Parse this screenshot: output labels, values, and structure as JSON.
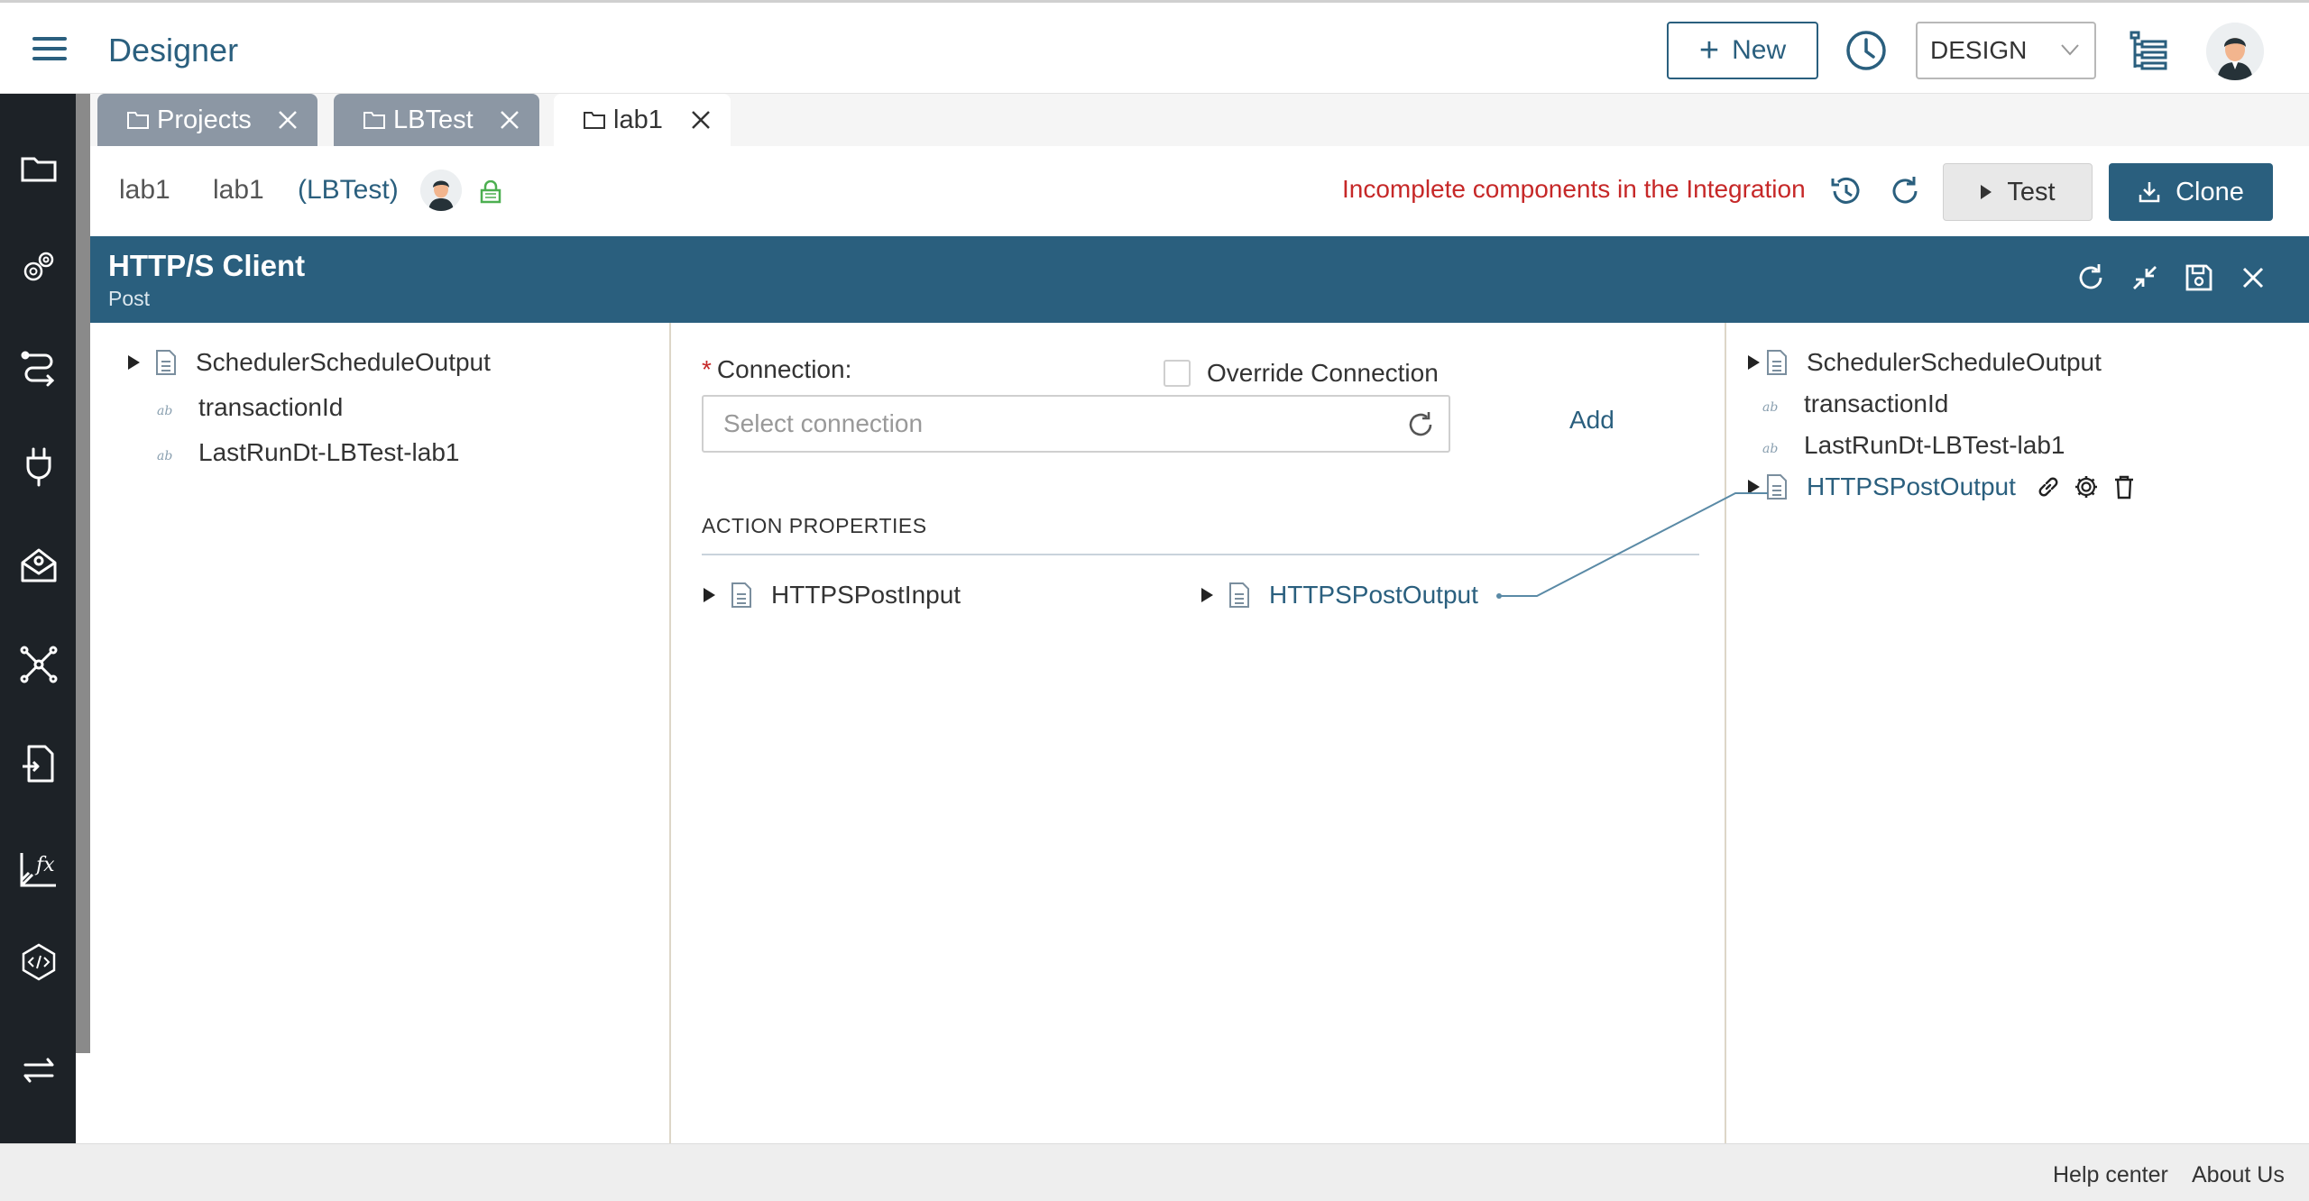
{
  "header": {
    "app_title": "Designer",
    "new_button": "New",
    "mode_select_value": "DESIGN"
  },
  "tabs": [
    {
      "label": "Projects",
      "active": false
    },
    {
      "label": "LBTest",
      "active": false
    },
    {
      "label": "lab1",
      "active": true
    }
  ],
  "infobar": {
    "crumb1": "lab1",
    "crumb2": "lab1",
    "project": "(LBTest)",
    "warning": "Incomplete components in the Integration",
    "test_button": "Test",
    "clone_button": "Clone"
  },
  "panel": {
    "title": "HTTP/S Client",
    "subtitle": "Post"
  },
  "left_tree": [
    {
      "label": "SchedulerScheduleOutput",
      "type": "doc",
      "expandable": true
    },
    {
      "label": "transactionId",
      "type": "string"
    },
    {
      "label": "LastRunDt-LBTest-lab1",
      "type": "string"
    }
  ],
  "connection": {
    "label": "Connection",
    "colon": ":",
    "required_mark": "*",
    "placeholder": "Select connection",
    "override_label": "Override Connection",
    "add_link": "Add"
  },
  "action_properties": {
    "heading": "ACTION PROPERTIES",
    "input_node": "HTTPSPostInput",
    "output_node": "HTTPSPostOutput"
  },
  "right_tree": [
    {
      "label": "SchedulerScheduleOutput",
      "type": "doc",
      "expandable": true
    },
    {
      "label": "transactionId",
      "type": "string"
    },
    {
      "label": "LastRunDt-LBTest-lab1",
      "type": "string"
    },
    {
      "label": "HTTPSPostOutput",
      "type": "doc",
      "expandable": true,
      "mapped": true
    }
  ],
  "string_icon_text": "ab",
  "footer": {
    "help": "Help center",
    "about": "About Us"
  },
  "colors": {
    "primary": "#2a5f7e",
    "sidebar": "#1d2227",
    "warning": "#c62828"
  },
  "icons": {
    "sidebar": [
      "folder-icon",
      "gears-icon",
      "flow-icon",
      "plug-icon",
      "inbox-icon",
      "network-icon",
      "file-transfer-icon",
      "function-icon",
      "code-hex-icon",
      "swap-icon"
    ]
  }
}
